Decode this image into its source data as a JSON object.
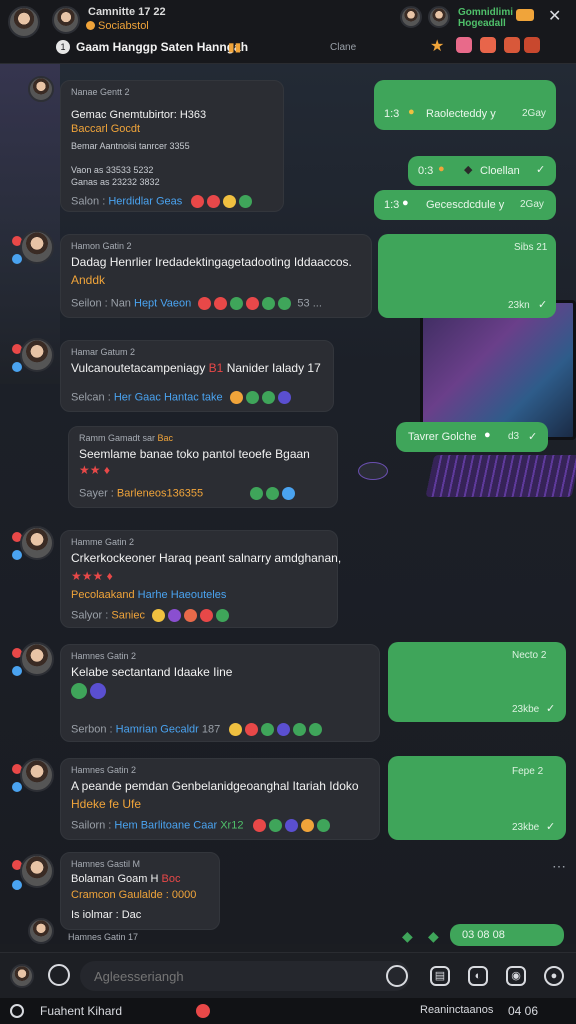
{
  "header": {
    "title": "Camnitte 17 22",
    "subtitle": "Sociabstol",
    "chat_title": "Gaam Hanggp Saten Hanngah",
    "center_label": "Clane",
    "right_title_1": "Gomnidlimi",
    "right_title_2": "Hogeadall",
    "badge": "1"
  },
  "messages": [
    {
      "name": "Nanae Gentt 2",
      "lines": [
        "Gemac Gnemtubirtor: H363",
        "Baccarl Gocdt"
      ],
      "small_lines": [
        "Bemar Aantnoisi tanrcer 3355",
        "Vaon as 33533 5232",
        "Ganas as 23232 3832"
      ],
      "meta_prefix": "Salon :",
      "meta_highlight": "Herdidlar Geas"
    },
    {
      "name": "Hamon Gatin 2",
      "line1": "Dadag Henrlier Iredadektingagetadooting Iddaaccos.",
      "line2": "Anddk",
      "meta_prefix": "Seilon : Nan",
      "meta_highlight": "Hept Vaeon",
      "meta_suffix": "53 ..."
    },
    {
      "name": "Hamar Gatum 2",
      "line1": "Vulcanoutetacampeniagy",
      "line1_accent": "B1",
      "line1_tail": "Nanider Ialady 17",
      "meta_prefix": "Selcan :",
      "meta_highlight": "Her Gaac Hantac take"
    },
    {
      "name": "Ramm Gamadt sar",
      "name_accent": "Bac",
      "line1": "Seemlame banae toko pantol teoefe Bgaan",
      "meta_prefix": "Sayer :",
      "meta_highlight": "Barleneos136355"
    },
    {
      "name": "Hamme Gatin 2",
      "line1": "Crkerkockeoner Haraq peant salnarry amdghanan,",
      "meta_prefix": "Salyor :",
      "meta_highlight": "Saniec",
      "green_line_a": "Pecolaakand",
      "green_line_b": "Harhe Haeouteles"
    },
    {
      "name": "Hamnes Gatin 2",
      "line1": "Kelabe sectantand Idaake Iine",
      "meta_prefix": "Serbon :",
      "meta_highlight": "Hamrian Gecaldr",
      "meta_suffix": "187"
    },
    {
      "name": "Hamnes Gatin 2",
      "line1": "A peande pemdan Genbelanidgeoanghal Itariah Idoko",
      "line2": "Hdeke fe Ufe",
      "meta_prefix": "Sailorn :",
      "meta_highlight": "Hem Barlitoane Caar",
      "meta_suffix": "Xr12"
    },
    {
      "name": "Hamnes Gastil M",
      "line1": "Bolaman Goam H",
      "line1_accent": "Boc",
      "line2": "Cramcon Gaulalde : 0000",
      "line3": "Is iolmar : Dac"
    }
  ],
  "last_label": "Hamnes Gatin 17",
  "outgoing": [
    {
      "text": "Raolecteddy y",
      "prefix": "1:3",
      "time": "2Gay"
    },
    {
      "text": "Cloellan",
      "prefix": "0:3",
      "time": ""
    },
    {
      "text": "Gecescdcdule y",
      "prefix": "1:3",
      "time": "2Gay"
    },
    {
      "text": "",
      "prefix": "",
      "time_top": "Sibs 21",
      "time": "23kn"
    },
    {
      "text": "Tavrer Golche",
      "prefix": "",
      "time": "d3"
    },
    {
      "text": "",
      "prefix": "",
      "time_top": "Necto 2",
      "time": "23kbe"
    },
    {
      "text": "",
      "prefix": "",
      "time_top": "Fepe 2",
      "time": "23kbe"
    },
    {
      "text": "03 08 08",
      "prefix": "",
      "time": ""
    }
  ],
  "input": {
    "placeholder": "Agleesseriangh"
  },
  "footer": {
    "left": "Fuahent Kihard",
    "right": "Reaninctaanos",
    "right_time": "04 06"
  },
  "colors": {
    "accent_green": "#3fa55a",
    "bubble_dark": "#2b2d33",
    "link_blue": "#4aa3f0",
    "orange": "#f0a43a"
  }
}
